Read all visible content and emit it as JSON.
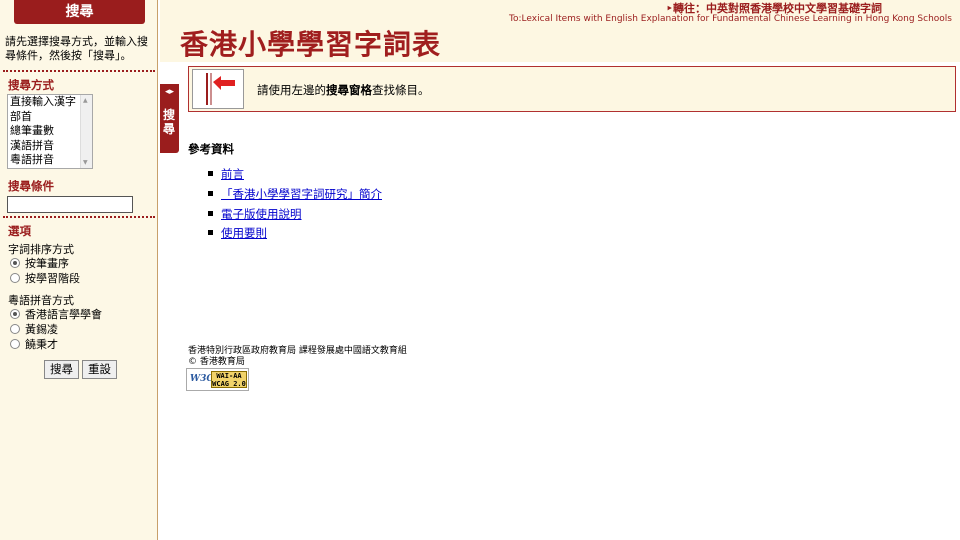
{
  "sidebar": {
    "header": "搜尋",
    "intro": "請先選擇搜尋方式，並輸入搜尋條件，然後按「搜尋」。",
    "method_title": "搜尋方式",
    "methods": [
      "直接輸入漢字",
      "部首",
      "總筆畫數",
      "漢語拼音",
      "粵語拼音"
    ],
    "condition_title": "搜尋條件",
    "condition_value": "",
    "options_title": "選項",
    "sort_label": "字詞排序方式",
    "sort_options": [
      {
        "label": "按筆畫序",
        "selected": true
      },
      {
        "label": "按學習階段",
        "selected": false
      }
    ],
    "jyutping_label": "粵語拼音方式",
    "jyutping_options": [
      {
        "label": "香港語言學學會",
        "selected": true
      },
      {
        "label": "黃錫凌",
        "selected": false
      },
      {
        "label": "饒秉才",
        "selected": false
      }
    ],
    "search_button": "搜尋",
    "reset_button": "重設"
  },
  "toggle_tab": {
    "arrows": "◂▸",
    "label": "搜尋"
  },
  "header": {
    "top_link": "‣轉往：中英對照香港學校中文學習基礎字詞",
    "top_sub": "To:Lexical Items with English Explanation for Fundamental Chinese Learning in Hong Kong Schools",
    "title": "香港小學學習字詞表"
  },
  "notice": {
    "prefix": "請使用左邊的",
    "bold": "搜尋窗格",
    "suffix": "查找條目。"
  },
  "references": {
    "heading": "參考資料",
    "items": [
      "前言",
      "「香港小學學習字詞研究」簡介",
      "電子版使用說明",
      "使用要則"
    ]
  },
  "footer": {
    "line1": "香港特別行政區政府教育局 課程發展處中國語文教育組",
    "line2": "© 香港教育局",
    "badge_logo": "W3C",
    "badge_line1": "WAI-AA",
    "badge_line2": "WCAG 2.0"
  },
  "colors": {
    "accent": "#9a1d1d",
    "panel_bg": "#fdf8e6",
    "link": "#0000cc"
  }
}
